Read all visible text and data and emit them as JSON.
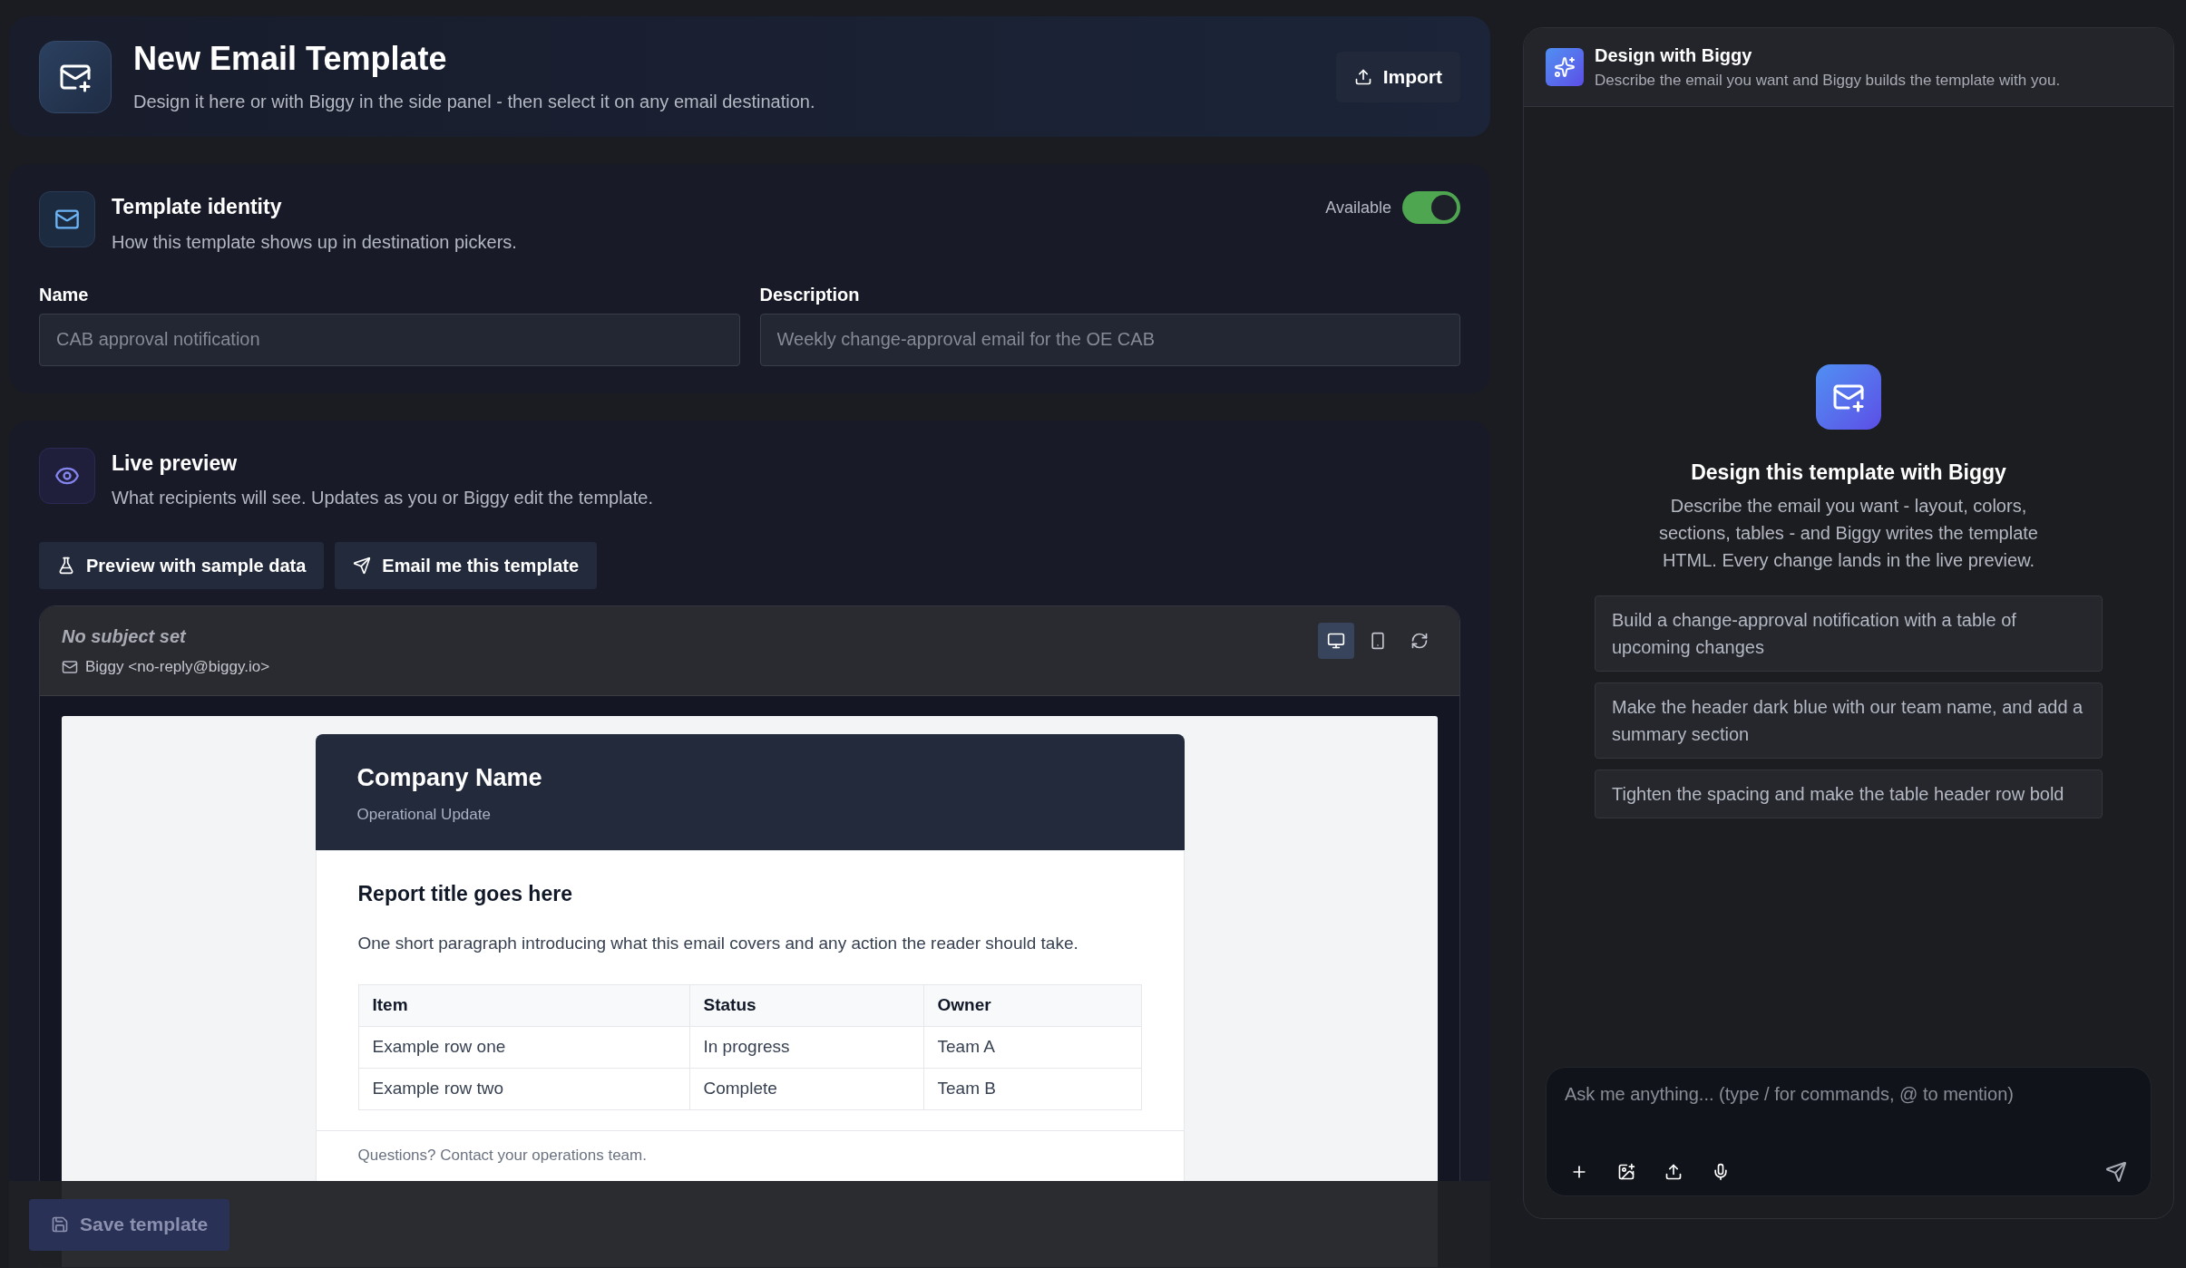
{
  "header": {
    "title": "New Email Template",
    "subtitle": "Design it here or with Biggy in the side panel - then select it on any email destination.",
    "import_button": "Import"
  },
  "identity": {
    "title": "Template identity",
    "subtitle": "How this template shows up in destination pickers.",
    "available": {
      "label": "Available",
      "on": true
    },
    "fields": [
      {
        "label": "Name",
        "placeholder": "CAB approval notification"
      },
      {
        "label": "Description",
        "placeholder": "Weekly change-approval email for the OE CAB"
      }
    ]
  },
  "preview": {
    "title": "Live preview",
    "subtitle": "What recipients will see. Updates as you or Biggy edit the template.",
    "actions": [
      {
        "kind": "flask",
        "label": "Preview with sample data"
      },
      {
        "kind": "send",
        "label": "Email me this template"
      }
    ],
    "subject": "No subject set",
    "sender": "Biggy <no-reply@biggy.io>",
    "view_modes": [
      {
        "kind": "desktop",
        "selected": true
      },
      {
        "kind": "mobile",
        "selected": false
      }
    ],
    "email": {
      "company": "Company Name",
      "tagline": "Operational Update",
      "report_title": "Report title goes here",
      "paragraph": "One short paragraph introducing what this email covers and any action the reader should take.",
      "columns": [
        "Item",
        "Status",
        "Owner"
      ],
      "rows": [
        [
          "Example row one",
          "In progress",
          "Team A"
        ],
        [
          "Example row two",
          "Complete",
          "Team B"
        ]
      ],
      "footer": "Questions? Contact your operations team."
    }
  },
  "save_button": {
    "label": "Save template",
    "disabled": true
  },
  "biggy": {
    "title": "Design with Biggy",
    "subtitle": "Describe the email you want and Biggy builds the template with you.",
    "empty_title": "Design this template with Biggy",
    "empty_text": "Describe the email you want - layout, colors, sections, tables - and Biggy writes the template HTML. Every change lands in the live preview.",
    "suggestions": [
      "Build a change-approval notification with a table of upcoming changes",
      "Make the header dark blue with our team name, and add a summary section",
      "Tighten the spacing and make the table header row bold"
    ],
    "composer": {
      "placeholder": "Ask me anything... (type / for commands, @ to mention)"
    }
  }
}
